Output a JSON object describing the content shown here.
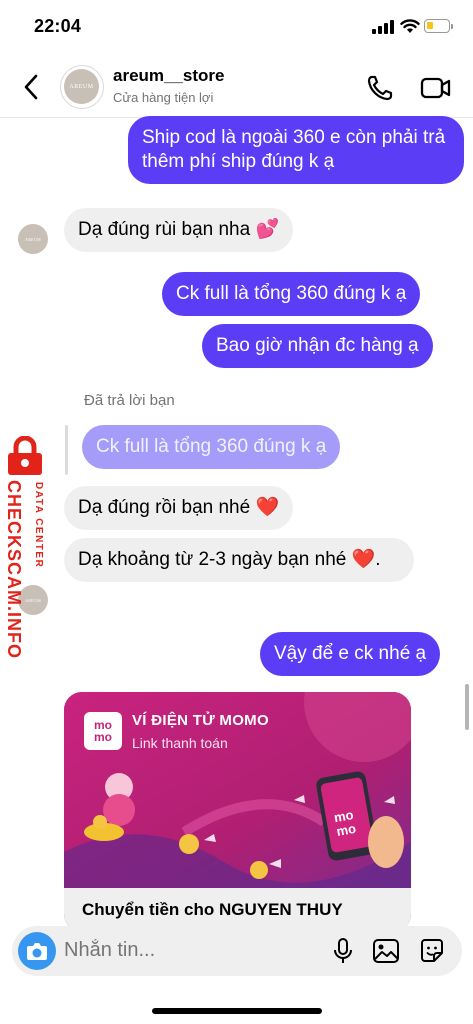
{
  "status_bar": {
    "time": "22:04"
  },
  "header": {
    "name": "areum__store",
    "subtitle": "Cửa hàng tiện lợi",
    "avatar_text": "AREUM"
  },
  "messages": [
    {
      "side": "out",
      "text": "Ship cod là ngoài 360 e còn phải trả thêm phí ship đúng k ạ"
    },
    {
      "side": "in",
      "text": "Dạ đúng rùi bạn nha 💕"
    },
    {
      "side": "out",
      "text": "Ck full là tổng 360 đúng k ạ"
    },
    {
      "side": "out",
      "text": "Bao giờ nhận đc hàng ạ"
    },
    {
      "side": "in",
      "text": "Dạ đúng rồi bạn nhé ❤️"
    },
    {
      "side": "in",
      "text": "Dạ khoảng từ 2-3 ngày bạn nhé ❤️."
    },
    {
      "side": "out",
      "text": "Vậy để e ck nhé ạ"
    }
  ],
  "reply": {
    "label": "Đã trả lời bạn",
    "quoted_text": "Ck full là tổng 360 đúng k ạ"
  },
  "payment_card": {
    "logo_top": "mo",
    "logo_bottom": "mo",
    "title": "VÍ ĐIỆN TỬ MOMO",
    "subtitle": "Link thanh toán",
    "caption": "Chuyển tiền cho NGUYEN THUY",
    "brand_color": "#c2247d"
  },
  "watermark": {
    "main": "CHECKSCAM.INFO",
    "sub": "DATA CENTER",
    "color": "#e2231a"
  },
  "composer": {
    "placeholder": "Nhắn tin..."
  },
  "colors": {
    "outgoing": "#5b3df6",
    "incoming": "#efefef",
    "accent": "#3797f0"
  }
}
